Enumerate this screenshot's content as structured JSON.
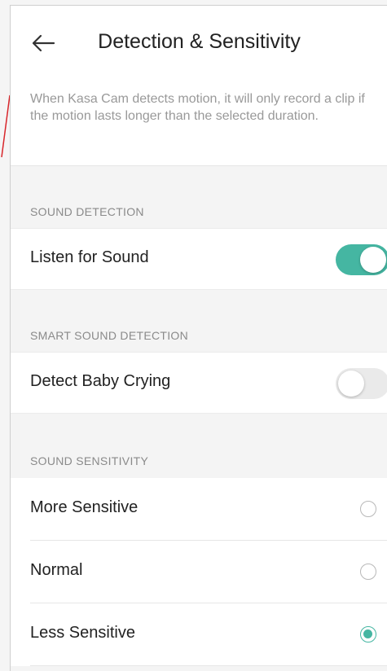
{
  "header": {
    "back_icon": "arrow-left-icon",
    "title": "Detection & Sensitivity"
  },
  "description": "When Kasa Cam detects motion, it will only record a clip if the motion lasts longer than the selected duration.",
  "sound_detection": {
    "section_title": "SOUND DETECTION",
    "listen_label": "Listen for Sound",
    "listen_enabled": true
  },
  "smart_sound_detection": {
    "section_title": "SMART SOUND DETECTION",
    "baby_crying_label": "Detect Baby Crying",
    "baby_crying_enabled": false
  },
  "sound_sensitivity": {
    "section_title": "SOUND SENSITIVITY",
    "options": [
      {
        "label": "More Sensitive",
        "selected": false
      },
      {
        "label": "Normal",
        "selected": false
      },
      {
        "label": "Less Sensitive",
        "selected": true
      }
    ]
  },
  "colors": {
    "accent": "#45b6a2",
    "background": "#f4f4f4",
    "annotation_mark": "#d8262b"
  }
}
